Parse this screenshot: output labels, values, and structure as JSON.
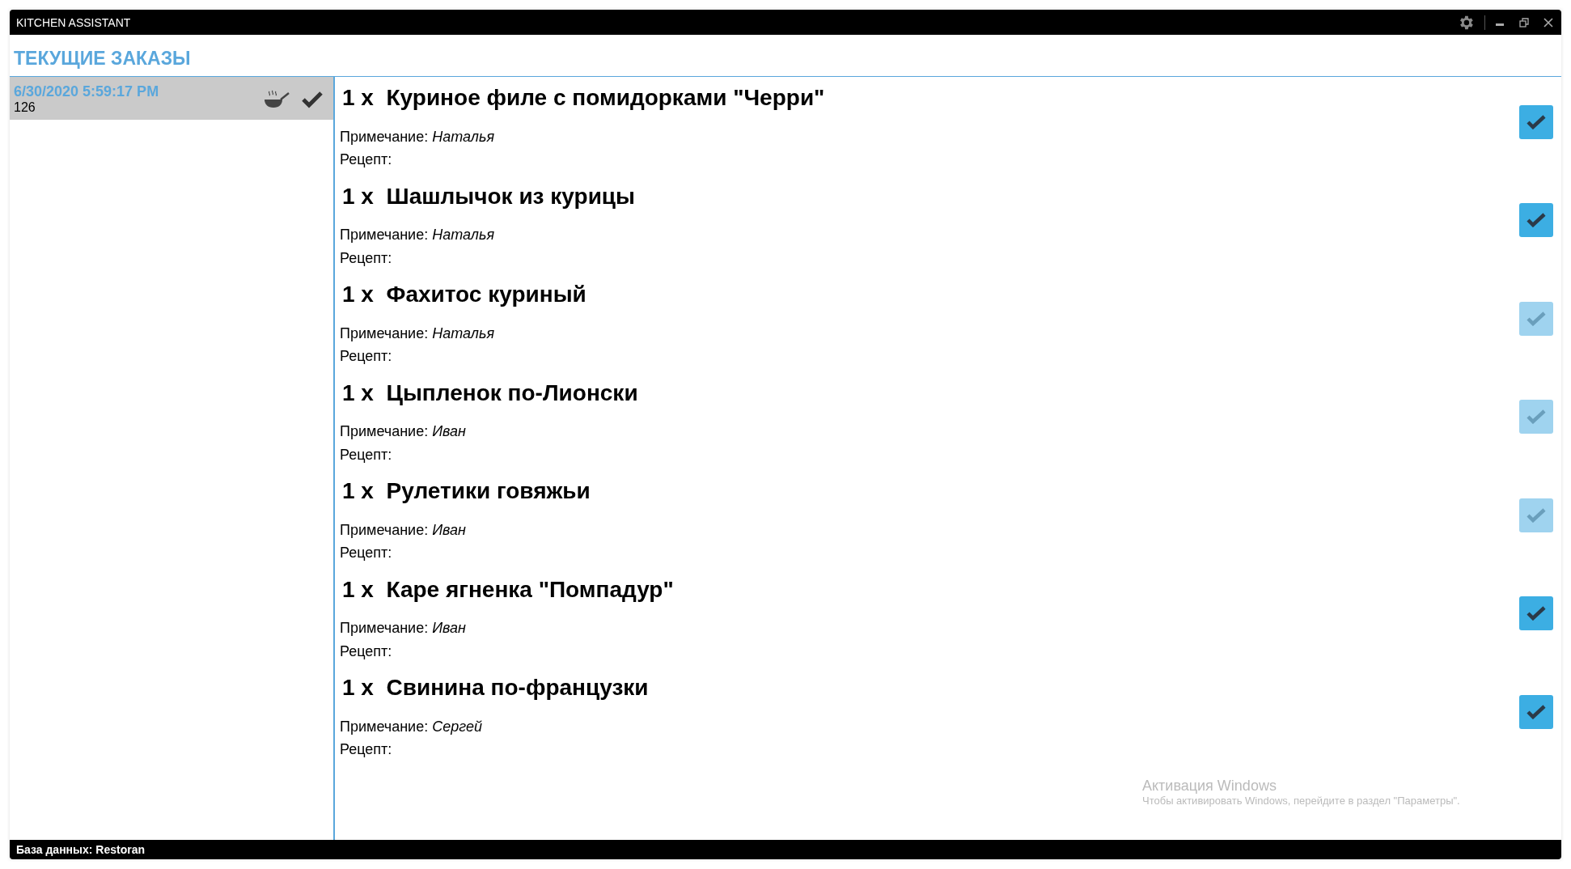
{
  "window": {
    "title": "KITCHEN ASSISTANT"
  },
  "heading": "ТЕКУЩИЕ ЗАКАЗЫ",
  "orders": [
    {
      "time": "6/30/2020 5:59:17 PM",
      "number": "126",
      "selected": true
    }
  ],
  "items": [
    {
      "quantity": "1 x",
      "name": "Куриное филе с помидорками \"Черри\"",
      "note_label": "Примечание:",
      "note": "Наталья",
      "recipe_label": "Рецепт:",
      "disabled": false
    },
    {
      "quantity": "1 x",
      "name": "Шашлычок из курицы",
      "note_label": "Примечание:",
      "note": "Наталья",
      "recipe_label": "Рецепт:",
      "disabled": false
    },
    {
      "quantity": "1 x",
      "name": "Фахитос куриный",
      "note_label": "Примечание:",
      "note": "Наталья",
      "recipe_label": "Рецепт:",
      "disabled": true
    },
    {
      "quantity": "1 x",
      "name": "Цыпленок по-Лионски",
      "note_label": "Примечание:",
      "note": "Иван",
      "recipe_label": "Рецепт:",
      "disabled": true
    },
    {
      "quantity": "1 x",
      "name": "Рулетики говяжьи",
      "note_label": "Примечание:",
      "note": "Иван",
      "recipe_label": "Рецепт:",
      "disabled": true
    },
    {
      "quantity": "1 x",
      "name": "Каре ягненка \"Помпадур\"",
      "note_label": "Примечание:",
      "note": "Иван",
      "recipe_label": "Рецепт:",
      "disabled": false
    },
    {
      "quantity": "1 x",
      "name": "Свинина по-французки",
      "note_label": "Примечание:",
      "note": "Сергей",
      "recipe_label": "Рецепт:",
      "disabled": false
    }
  ],
  "activation_notice": {
    "title": "Активация Windows",
    "text": "Чтобы активировать Windows, перейдите в раздел \"Параметры\"."
  },
  "status_bar": "База данных: Restoran"
}
